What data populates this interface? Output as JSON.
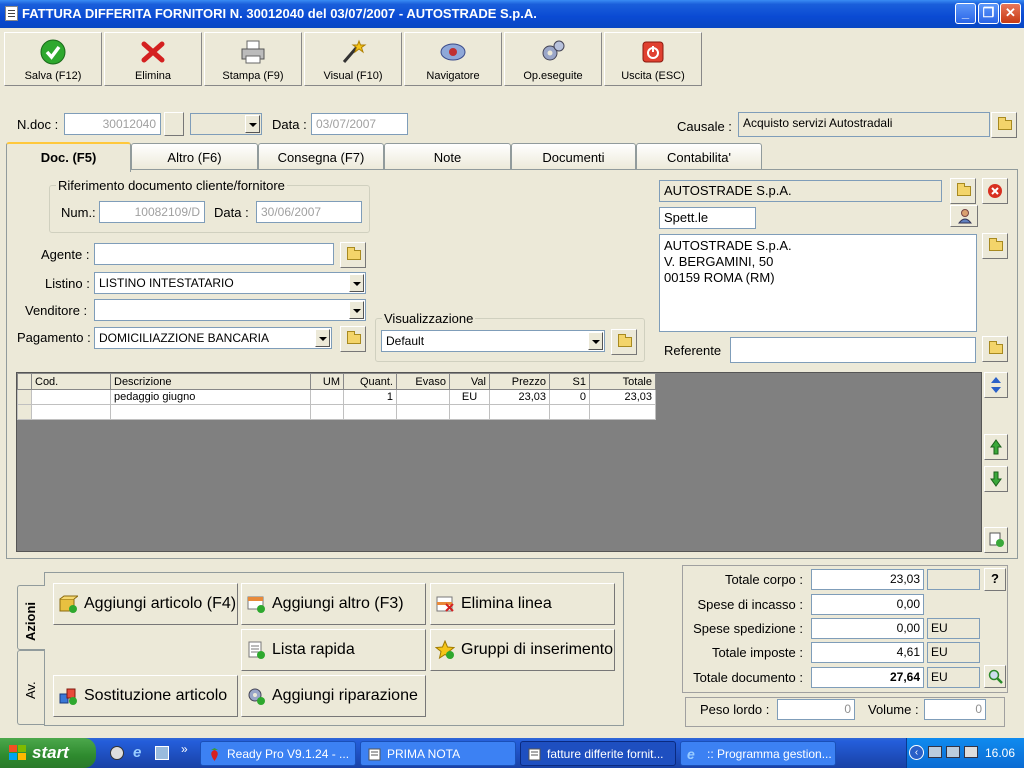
{
  "window": {
    "title": "FATTURA DIFFERITA FORNITORI N. 30012040  del 03/07/2007 - AUTOSTRADE S.p.A.",
    "minimize": "_",
    "maximize": "❐",
    "close": "✕"
  },
  "toolbar": [
    {
      "label": "Salva (F12)",
      "icon": "save-check-icon"
    },
    {
      "label": "Elimina",
      "icon": "delete-x-icon"
    },
    {
      "label": "Stampa (F9)",
      "icon": "printer-icon"
    },
    {
      "label": "Visual (F10)",
      "icon": "magic-wand-icon"
    },
    {
      "label": "Navigatore",
      "icon": "navigator-icon"
    },
    {
      "label": "Op.eseguite",
      "icon": "gears-icon"
    },
    {
      "label": "Uscita (ESC)",
      "icon": "exit-icon"
    }
  ],
  "header": {
    "ndoc_label": "N.doc :",
    "ndoc_value": "30012040",
    "data_label": "Data :",
    "data_value": "03/07/2007",
    "causale_label": "Causale :",
    "causale_value": "Acquisto servizi Autostradali"
  },
  "tabs": [
    "Doc. (F5)",
    "Altro (F6)",
    "Consegna (F7)",
    "Note",
    "Documenti",
    "Contabilita'"
  ],
  "riferimento": {
    "title": "Riferimento documento cliente/fornitore",
    "num_label": "Num.:",
    "num_value": "10082109/D",
    "data_label": "Data :",
    "data_value": "30/06/2007"
  },
  "form": {
    "agente_label": "Agente :",
    "agente_value": "",
    "listino_label": "Listino :",
    "listino_value": "LISTINO INTESTATARIO",
    "venditore_label": "Venditore :",
    "venditore_value": "",
    "pagamento_label": "Pagamento :",
    "pagamento_value": "DOMICILIAZZIONE BANCARIA",
    "visualizzazione_title": "Visualizzazione",
    "visualizzazione_value": "Default"
  },
  "fornitore": {
    "name": "AUTOSTRADE S.p.A.",
    "salutation": "Spett.le",
    "address_lines": [
      "AUTOSTRADE S.p.A.",
      "V. BERGAMINI, 50",
      "00159 ROMA (RM)"
    ],
    "referente_label": "Referente",
    "referente_value": ""
  },
  "grid": {
    "columns": [
      "Cod.",
      "Descrizione",
      "UM",
      "Quant.",
      "Evaso",
      "Val",
      "Prezzo",
      "S1",
      "Totale"
    ],
    "rows": [
      [
        "",
        "pedaggio giugno",
        "",
        "1",
        "",
        "EU",
        "23,03",
        "0",
        "23,03"
      ],
      [
        "",
        "",
        "",
        "",
        "",
        "",
        "",
        "",
        ""
      ]
    ]
  },
  "actions": {
    "vtab_main": "Azioni",
    "vtab_av": "Av.",
    "buttons": {
      "aggiungi_articolo": "Aggiungi articolo (F4)",
      "aggiungi_altro": "Aggiungi altro (F3)",
      "elimina_linea": "Elimina linea",
      "lista_rapida": "Lista rapida",
      "gruppi_inserimento": "Gruppi di inserimento",
      "sostituzione_articolo": "Sostituzione articolo",
      "aggiungi_riparazione": "Aggiungi riparazione"
    }
  },
  "totals": {
    "totale_corpo_label": "Totale corpo :",
    "totale_corpo": "23,03",
    "spese_incasso_label": "Spese di incasso :",
    "spese_incasso": "0,00",
    "spese_spedizione_label": "Spese spedizione :",
    "spese_spedizione": "0,00",
    "spese_spedizione_unit": "EU",
    "totale_imposte_label": "Totale imposte :",
    "totale_imposte": "4,61",
    "totale_imposte_unit": "EU",
    "totale_documento_label": "Totale documento :",
    "totale_documento": "27,64",
    "totale_documento_unit": "EU",
    "help": "?",
    "peso_lordo_label": "Peso lordo :",
    "peso_lordo": "0",
    "volume_label": "Volume :",
    "volume": "0"
  },
  "taskbar": {
    "start": "start",
    "quicklaunch_more": "»",
    "tasks": [
      "Ready Pro V9.1.24 - ...",
      "PRIMA NOTA",
      "fatture differite fornit...",
      ":: Programma gestion..."
    ],
    "clock": "16.06"
  },
  "colors": {
    "titlebar": "#0A4AD3",
    "window_bg": "#ECE9D8",
    "grid_bg": "#808080",
    "taskbar": "#245EDB",
    "start_green": "#2E8A2E"
  }
}
